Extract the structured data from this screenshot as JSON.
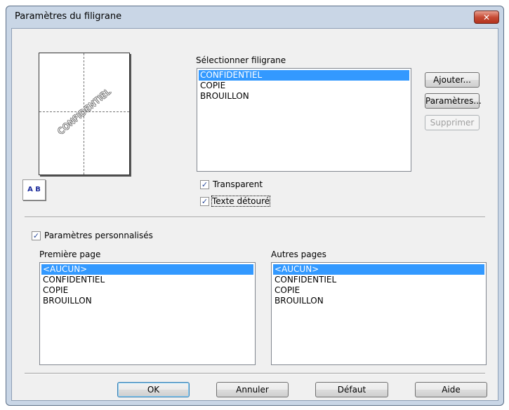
{
  "window": {
    "title": "Paramètres du filigrane",
    "close_glyph": "✕"
  },
  "preview": {
    "watermark_text": "CONFIDENTIEL",
    "ab_icon_text": "A B"
  },
  "select_watermark": {
    "label": "Sélectionner filigrane",
    "items": [
      "CONFIDENTIEL",
      "COPIE",
      "BROUILLON"
    ],
    "selected_index": 0
  },
  "buttons": {
    "add": "Ajouter...",
    "settings": "Paramètres...",
    "delete": "Supprimer",
    "ok": "OK",
    "cancel": "Annuler",
    "default": "Défaut",
    "help": "Aide"
  },
  "options": {
    "transparent": {
      "label": "Transparent",
      "checked": true
    },
    "outline_text": {
      "label": "Texte détouré",
      "checked": true
    },
    "custom_settings": {
      "label": "Paramètres personnalisés",
      "checked": true
    }
  },
  "first_page": {
    "label": "Première page",
    "items": [
      "<AUCUN>",
      "CONFIDENTIEL",
      "COPIE",
      "BROUILLON"
    ],
    "selected_index": 0
  },
  "other_pages": {
    "label": "Autres pages",
    "items": [
      "<AUCUN>",
      "CONFIDENTIEL",
      "COPIE",
      "BROUILLON"
    ],
    "selected_index": 0
  },
  "colors": {
    "titlebar": "#c9d6e6",
    "selection": "#3399ff",
    "client": "#f0f0f0"
  }
}
